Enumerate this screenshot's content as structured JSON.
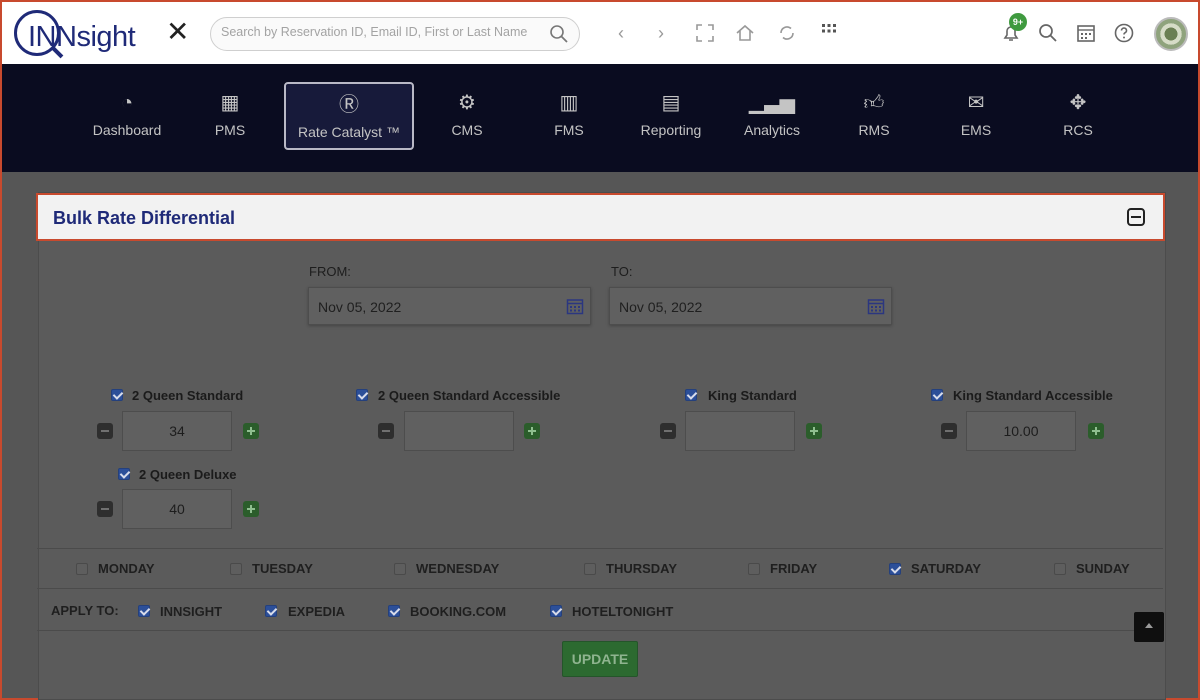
{
  "header": {
    "logo_text": "INNsight",
    "search_placeholder": "Search by Reservation ID, Email ID, First or Last Name",
    "notification_badge": "9+"
  },
  "nav": {
    "items": [
      {
        "label": "Dashboard",
        "icon": "gauge-icon"
      },
      {
        "label": "PMS",
        "icon": "calendar-grid-icon"
      },
      {
        "label": "Rate Catalyst ™",
        "icon": "rate-catalyst-icon",
        "active": true
      },
      {
        "label": "CMS",
        "icon": "gear-icon"
      },
      {
        "label": "FMS",
        "icon": "building-icon"
      },
      {
        "label": "Reporting",
        "icon": "document-icon"
      },
      {
        "label": "Analytics",
        "icon": "bar-chart-icon"
      },
      {
        "label": "RMS",
        "icon": "thumbs-up-icon"
      },
      {
        "label": "EMS",
        "icon": "envelope-icon"
      },
      {
        "label": "RCS",
        "icon": "crosshair-icon"
      }
    ]
  },
  "panel": {
    "title": "Bulk Rate Differential",
    "from_label": "FROM:",
    "from_value": "Nov 05, 2022",
    "to_label": "TO:",
    "to_value": "Nov 05, 2022"
  },
  "rooms": [
    {
      "name": "2 Queen Standard",
      "checked": true,
      "value": "34"
    },
    {
      "name": "2 Queen Standard Accessible",
      "checked": true,
      "value": ""
    },
    {
      "name": "King Standard",
      "checked": true,
      "value": ""
    },
    {
      "name": "King Standard Accessible",
      "checked": true,
      "value": "10.00"
    },
    {
      "name": "2 Queen Deluxe",
      "checked": true,
      "value": "40"
    }
  ],
  "days": [
    {
      "name": "MONDAY",
      "checked": false
    },
    {
      "name": "TUESDAY",
      "checked": false
    },
    {
      "name": "WEDNESDAY",
      "checked": false
    },
    {
      "name": "THURSDAY",
      "checked": false
    },
    {
      "name": "FRIDAY",
      "checked": false
    },
    {
      "name": "SATURDAY",
      "checked": true
    },
    {
      "name": "SUNDAY",
      "checked": false
    }
  ],
  "apply": {
    "label": "APPLY TO:",
    "channels": [
      {
        "name": "INNSIGHT",
        "checked": true
      },
      {
        "name": "EXPEDIA",
        "checked": true
      },
      {
        "name": "BOOKING.COM",
        "checked": true
      },
      {
        "name": "HOTELTONIGHT",
        "checked": true
      }
    ]
  },
  "actions": {
    "update_label": "UPDATE"
  },
  "colors": {
    "brand": "#1f2a78",
    "nav_bg": "#0a0c20",
    "highlight": "#c84a2e",
    "check": "#2c4f99",
    "update": "#2c6a30"
  }
}
